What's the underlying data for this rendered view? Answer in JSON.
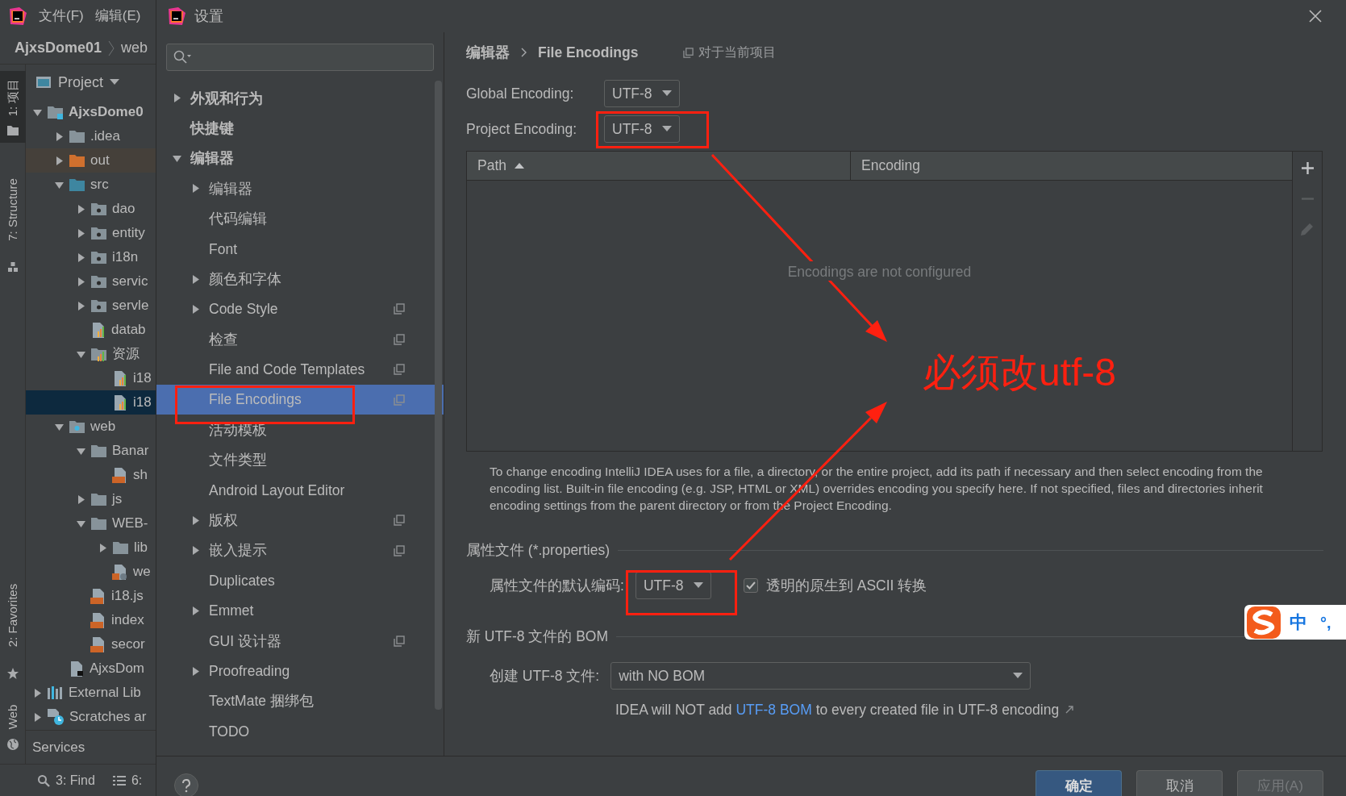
{
  "ide": {
    "menu": [
      "文件(F)",
      "编辑(E)"
    ],
    "breadcrumb": [
      "AjxsDome01",
      "web"
    ],
    "tool_tabs_top": [
      {
        "label": "1: 项目",
        "selected": true,
        "kind": "project"
      },
      {
        "label": "7: Structure",
        "selected": false,
        "kind": "structure"
      }
    ],
    "tool_tabs_bottom": [
      {
        "label": "2: Favorites",
        "selected": false,
        "kind": "favorites"
      },
      {
        "label": "Web",
        "selected": false,
        "kind": "web"
      }
    ],
    "project_header": "Project",
    "tree": [
      {
        "label": "AjxsDome0",
        "kind": "module",
        "expanded": true,
        "selected": false,
        "children": [
          {
            "label": ".idea",
            "kind": "folder",
            "expanded": false,
            "selected": false
          },
          {
            "label": "out",
            "kind": "excluded-folder",
            "expanded": false,
            "selected": false
          },
          {
            "label": "src",
            "kind": "source-folder",
            "expanded": true,
            "selected": false,
            "children": [
              {
                "label": "dao",
                "kind": "package",
                "expanded": false,
                "selected": false
              },
              {
                "label": "entity",
                "kind": "package",
                "expanded": false,
                "selected": false
              },
              {
                "label": "i18n",
                "kind": "package",
                "expanded": false,
                "selected": false
              },
              {
                "label": "servic",
                "kind": "package",
                "expanded": false,
                "selected": false
              },
              {
                "label": "servle",
                "kind": "package",
                "expanded": false,
                "selected": false
              },
              {
                "label": "datab",
                "kind": "properties",
                "selected": false
              },
              {
                "label": "资源",
                "kind": "resource-bundle",
                "expanded": true,
                "selected": false,
                "children": [
                  {
                    "label": "i18",
                    "kind": "properties",
                    "selected": false
                  },
                  {
                    "label": "i18",
                    "kind": "properties",
                    "selected": true
                  }
                ]
              }
            ]
          },
          {
            "label": "web",
            "kind": "web-folder",
            "expanded": true,
            "selected": false,
            "children": [
              {
                "label": "Banar",
                "kind": "folder",
                "expanded": true,
                "selected": false,
                "children": [
                  {
                    "label": "sh",
                    "kind": "jsp",
                    "selected": false
                  }
                ]
              },
              {
                "label": "js",
                "kind": "folder",
                "expanded": false,
                "selected": false
              },
              {
                "label": "WEB-",
                "kind": "folder",
                "expanded": true,
                "selected": false,
                "children": [
                  {
                    "label": "lib",
                    "kind": "folder",
                    "expanded": false,
                    "selected": false
                  },
                  {
                    "label": "we",
                    "kind": "xml",
                    "selected": false
                  }
                ]
              },
              {
                "label": "i18.js",
                "kind": "jsp",
                "selected": false
              },
              {
                "label": "index",
                "kind": "jsp",
                "selected": false
              },
              {
                "label": "secor",
                "kind": "jsp",
                "selected": false
              }
            ]
          },
          {
            "label": "AjxsDom",
            "kind": "iml",
            "selected": false
          }
        ]
      },
      {
        "label": "External Lib",
        "kind": "library",
        "expanded": false,
        "selected": false
      },
      {
        "label": "Scratches ar",
        "kind": "scratches",
        "expanded": false,
        "selected": false
      }
    ],
    "services": "Services",
    "status_bar": [
      {
        "label": "3: Find",
        "kind": "find"
      },
      {
        "label": "6:",
        "kind": "todo"
      }
    ]
  },
  "dialog": {
    "title": "设置",
    "settings_tree": [
      {
        "label": "外观和行为",
        "expanded": false,
        "selected": false
      },
      {
        "label": "快捷键",
        "selected": false
      },
      {
        "label": "编辑器",
        "expanded": true,
        "selected": false,
        "children": [
          {
            "label": "编辑器",
            "expanded": false,
            "selected": false
          },
          {
            "label": "代码编辑",
            "selected": false
          },
          {
            "label": "Font",
            "selected": false
          },
          {
            "label": "颜色和字体",
            "expanded": false,
            "selected": false
          },
          {
            "label": "Code Style",
            "expanded": false,
            "selected": false,
            "project_scoped": true
          },
          {
            "label": "检查",
            "selected": false,
            "project_scoped": true
          },
          {
            "label": "File and Code Templates",
            "selected": false,
            "project_scoped": true
          },
          {
            "label": "File Encodings",
            "selected": true,
            "project_scoped": true
          },
          {
            "label": "活动模板",
            "selected": false
          },
          {
            "label": "文件类型",
            "selected": false
          },
          {
            "label": "Android Layout Editor",
            "selected": false
          },
          {
            "label": "版权",
            "expanded": false,
            "selected": false,
            "project_scoped": true
          },
          {
            "label": "嵌入提示",
            "expanded": false,
            "selected": false,
            "project_scoped": true
          },
          {
            "label": "Duplicates",
            "selected": false
          },
          {
            "label": "Emmet",
            "expanded": false,
            "selected": false
          },
          {
            "label": "GUI 设计器",
            "selected": false,
            "project_scoped": true
          },
          {
            "label": "Proofreading",
            "expanded": false,
            "selected": false
          },
          {
            "label": "TextMate 捆绑包",
            "selected": false
          },
          {
            "label": "TODO",
            "selected": false
          }
        ]
      }
    ],
    "breadcrumb": [
      "编辑器",
      "File Encodings"
    ],
    "scope_note": "对于当前项目",
    "global_encoding": {
      "label": "Global Encoding:",
      "value": "UTF-8"
    },
    "project_encoding": {
      "label": "Project Encoding:",
      "value": "UTF-8"
    },
    "table": {
      "columns": [
        {
          "label": "Path",
          "sorted": true
        },
        {
          "label": "Encoding",
          "sorted": false
        }
      ],
      "empty_text": "Encodings are not configured",
      "tools": [
        {
          "kind": "add",
          "disabled": false
        },
        {
          "kind": "remove",
          "disabled": true
        },
        {
          "kind": "edit",
          "disabled": true
        }
      ]
    },
    "description": "To change encoding IntelliJ IDEA uses for a file, a directory, or the entire project, add its path if necessary and then select encoding from the encoding list. Built-in file encoding (e.g. JSP, HTML or XML) overrides encoding you specify here. If not specified, files and directories inherit encoding settings from the parent directory or from the Project Encoding.",
    "properties_section": {
      "title": "属性文件 (*.properties)",
      "default_encoding": {
        "label": "属性文件的默认编码:",
        "value": "UTF-8"
      },
      "native_to_ascii": {
        "label": "透明的原生到 ASCII 转换",
        "checked": true
      }
    },
    "bom_section": {
      "title": "新 UTF-8 文件的 BOM",
      "create": {
        "label": "创建 UTF-8 文件:",
        "value": "with NO BOM"
      },
      "note": {
        "before": "IDEA will NOT add ",
        "link": "UTF-8 BOM",
        "after": " to every created file in UTF-8 encoding"
      }
    },
    "buttons": [
      {
        "label": "确定",
        "kind": "primary",
        "disabled": false
      },
      {
        "label": "取消",
        "kind": "normal",
        "disabled": false
      },
      {
        "label": "应用(A)",
        "kind": "normal",
        "disabled": true
      }
    ]
  },
  "ime_toolbar": {
    "mode": "中",
    "punctuation": "°,"
  },
  "annotation": {
    "text": "必须改utf-8"
  }
}
